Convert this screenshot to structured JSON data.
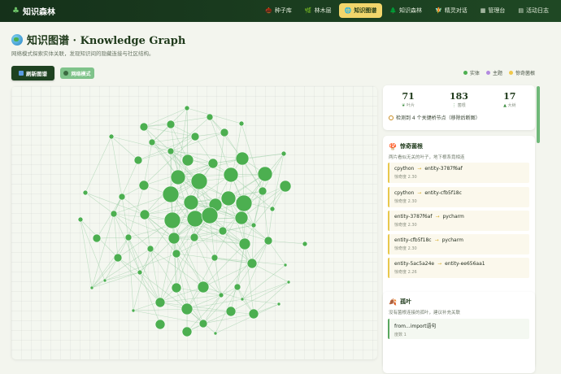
{
  "nav": {
    "brand": "知识森林",
    "items": [
      {
        "label": "种子库",
        "icon": "🌰"
      },
      {
        "label": "林木层",
        "icon": "🌿"
      },
      {
        "label": "知识图谱",
        "icon": "🌐",
        "active": true
      },
      {
        "label": "知识森林",
        "icon": "🌲"
      },
      {
        "label": "精灵对话",
        "icon": "🧚"
      },
      {
        "label": "管理台",
        "icon": "▦"
      },
      {
        "label": "活动日志",
        "icon": "▤"
      }
    ]
  },
  "header": {
    "title": "知识图谱 · Knowledge Graph",
    "subtitle": "网络模式探索实体关联，发现知识间的隐藏连接与社区结构。"
  },
  "toolbar": {
    "refresh_label": "刷新图谱",
    "mode_label": "网络模式"
  },
  "legend": [
    {
      "label": "实体",
      "color": "#4caf50"
    },
    {
      "label": "主题",
      "color": "#b38be0"
    },
    {
      "label": "惊奇菌根",
      "color": "#f0c84a"
    }
  ],
  "stats": {
    "items": [
      {
        "value": "71",
        "label": "叶片",
        "icon": "🍃"
      },
      {
        "value": "183",
        "label": "菌根",
        "icon": "⫶"
      },
      {
        "value": "17",
        "label": "大树",
        "icon": "🌲"
      }
    ],
    "bridge_note": "检测到 4 个关键桥节点（移除后断图）"
  },
  "surprising": {
    "title": "惊奇菌根",
    "desc": "两片看似无关的叶子，地下根系竟相连",
    "pairs": [
      {
        "a": "cpython",
        "b": "entity-3787f6af",
        "score": "惊奇度 2.30"
      },
      {
        "a": "cpython",
        "b": "entity-cfb5f18c",
        "score": "惊奇度 2.30"
      },
      {
        "a": "entity-3787f6af",
        "b": "pycharm",
        "score": "惊奇度 2.30"
      },
      {
        "a": "entity-cfb5f18c",
        "b": "pycharm",
        "score": "惊奇度 2.30"
      },
      {
        "a": "entity-5ac5a24e",
        "b": "entity-ee656aa1",
        "score": "惊奇度 2.26"
      }
    ]
  },
  "leaves": {
    "title": "孤叶",
    "desc": "没有菌根连接的孤叶，建议补充关联",
    "items": [
      {
        "name": "from...import语句",
        "degree": "度数 1"
      }
    ]
  },
  "colors": {
    "node": "#4caf50",
    "edge": "#8fc99a",
    "nav_bg": "#1f4824",
    "accent": "#f2d66b"
  }
}
